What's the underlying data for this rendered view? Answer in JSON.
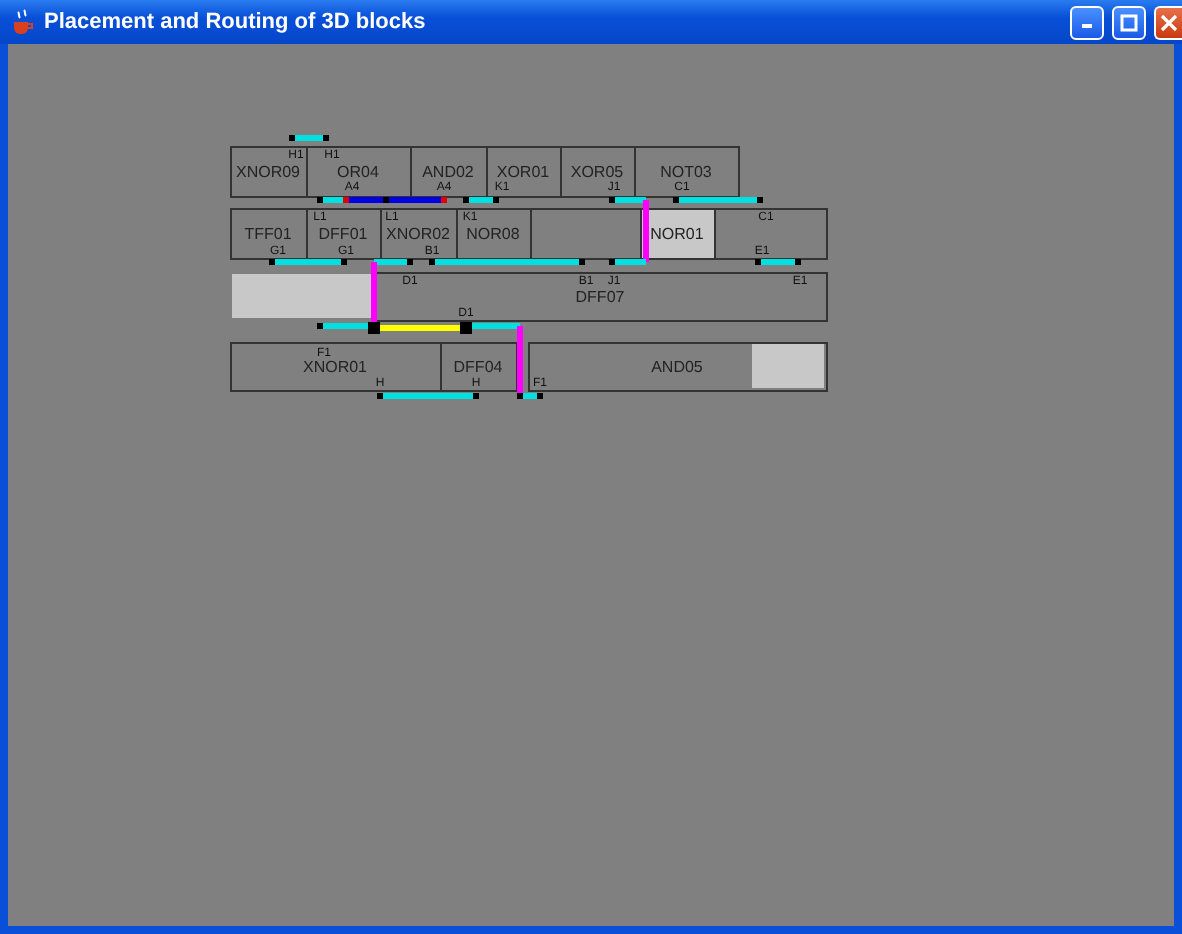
{
  "window": {
    "title": "Placement and Routing of 3D blocks"
  },
  "blocks": [
    {
      "label": "XNOR09",
      "shaded": false
    },
    {
      "label": "OR04",
      "shaded": false
    },
    {
      "label": "AND02",
      "shaded": false
    },
    {
      "label": "XOR01",
      "shaded": false
    },
    {
      "label": "XOR05",
      "shaded": false
    },
    {
      "label": "NOT03",
      "shaded": false
    },
    {
      "label": "TFF01",
      "shaded": false
    },
    {
      "label": "DFF01",
      "shaded": false
    },
    {
      "label": "XNOR02",
      "shaded": false
    },
    {
      "label": "NOR08",
      "shaded": false
    },
    {
      "label": "NOR01",
      "shaded": true
    },
    {
      "label": "DFF07",
      "shaded": false
    },
    {
      "label": "XNOR01",
      "shaded": false
    },
    {
      "label": "DFF04",
      "shaded": false
    },
    {
      "label": "AND05",
      "shaded": false
    }
  ],
  "pin_labels": [
    "H1",
    "H1",
    "A4",
    "A4",
    "K1",
    "J1",
    "C1",
    "L1",
    "L1",
    "K1",
    "C1",
    "G1",
    "G1",
    "B1",
    "E1",
    "D1",
    "B1",
    "J1",
    "E1",
    "D1",
    "F1",
    "H",
    "H",
    "F1"
  ]
}
